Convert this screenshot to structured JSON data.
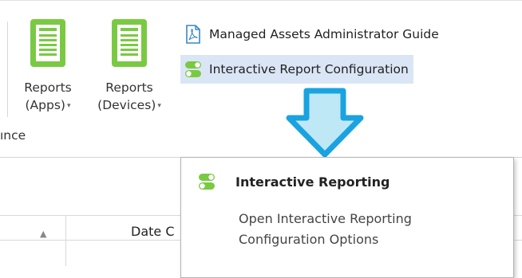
{
  "ribbon": {
    "buttons": [
      {
        "line1": "Reports",
        "line2": "(Apps)"
      },
      {
        "line1": "Reports",
        "line2": "(Devices)"
      }
    ],
    "group_label": "ınce",
    "links": [
      {
        "label": "Managed Assets Administrator Guide",
        "icon": "pdf-icon"
      },
      {
        "label": "Interactive Report Configuration",
        "icon": "toggle-icon"
      }
    ]
  },
  "tooltip": {
    "title": "Interactive Reporting",
    "description": "Open Interactive Reporting Configuration Options"
  },
  "table": {
    "column_date": "Date C"
  },
  "colors": {
    "accent_green": "#7ac943",
    "arrow_blue": "#1aa3e0",
    "highlight": "#dae6f5",
    "pdf_blue": "#3a86c8"
  }
}
